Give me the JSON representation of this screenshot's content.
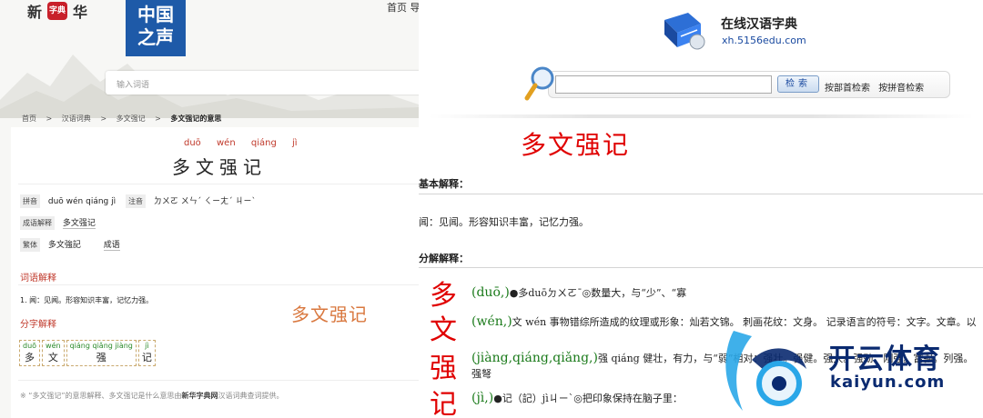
{
  "left": {
    "logo": {
      "left_char": "新",
      "seal_text": "字典",
      "right_char": "华"
    },
    "topnav": "首页  导",
    "cn_logo": {
      "line1": "中国",
      "line2": "之声"
    },
    "search_placeholder": "输入词语",
    "breadcrumb": [
      "首页",
      ">",
      "汉语词典",
      ">",
      "多文强记",
      ">",
      "多文强记的意思"
    ],
    "pinyin": [
      "duō",
      "wén",
      "qiáng",
      "jì"
    ],
    "word": "多文强记",
    "rows": {
      "pinyin_tag": "拼音",
      "pinyin_value": "duō wén qiáng jì",
      "zhuyin_tag": "注音",
      "zhuyin_value": "ㄉㄨㄛ ㄨㄣˊ ㄑㄧㄤˊ ㄐㄧˋ",
      "idiom_tag": "成语解释",
      "idiom_value": "多文强记",
      "trad_tag": "繁体",
      "trad_value": "多文強記",
      "trad_extra": "成语"
    },
    "section_meaning": "词语解释",
    "meaning_text": "1. 闻：见闻。形容知识丰富，记忆力强。",
    "overlay_word": "多文强记",
    "section_chars": "分字解释",
    "chars": [
      {
        "py": "duō",
        "ch": "多"
      },
      {
        "py": "wén",
        "ch": "文"
      },
      {
        "py": "qiáng qiǎng jiàng",
        "ch": "强"
      },
      {
        "py": "jì",
        "ch": "记"
      }
    ],
    "footnote_pre": "※ “多文强记”的意思解释、多文强记是什么意思由",
    "footnote_brand": "新华字典网",
    "footnote_post": "汉语词典查词提供。"
  },
  "right": {
    "site_name": "在线汉语字典",
    "site_url": "xh.5156edu.com",
    "search_button": "检索",
    "links": [
      "按部首检索",
      "按拼音检索"
    ],
    "title": "多文强记",
    "basic_head": "基本解释：",
    "basic_text": "闻：见闻。形容知识丰富，记忆力强。",
    "detail_head": "分解解释：",
    "vertical_chars": [
      "多",
      "文",
      "强",
      "记"
    ],
    "entries": [
      {
        "py": "(duō,)",
        "text": "●多duōㄉㄨㄛˉ◎数量大，与“少”、“寡"
      },
      {
        "py": "(wén,)",
        "text": "文 wén 事物错综所造成的纹理或形象：灿若文锦。 刺画花纹：文身。 记录语言的符号：文字。文章。以"
      },
      {
        "py": "(jiàng,qiáng,qiǎng,)",
        "text": "强 qiáng 健壮，有力，与“弱”相对：强壮。强健。强大。强劲。刚强。富强。列强。强弩"
      },
      {
        "py": "(jì,)",
        "text": "●记（記）jìㄐㄧˋ◎把印象保持在脑子里："
      }
    ],
    "watermark": {
      "brand": "开云体育",
      "url": "kaiyun.com"
    }
  }
}
